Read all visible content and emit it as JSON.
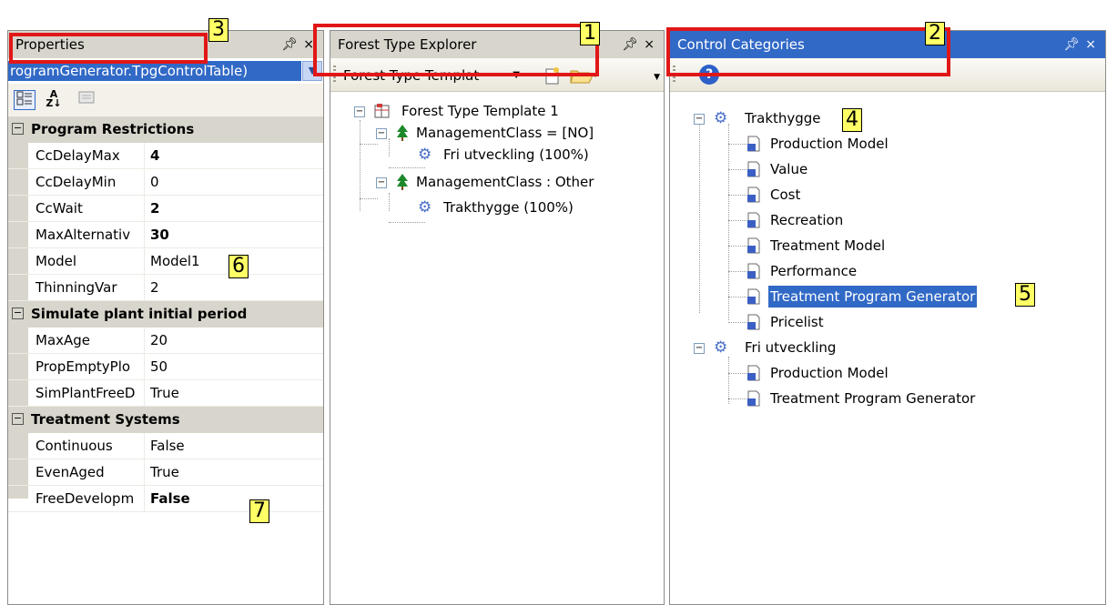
{
  "properties": {
    "title": "Properties",
    "selector": "rogramGenerator.TpgControlTable)",
    "categories": [
      {
        "name": "Program Restrictions",
        "rows": [
          {
            "key": "CcDelayMax",
            "value": "4",
            "bold": true
          },
          {
            "key": "CcDelayMin",
            "value": "0",
            "bold": false
          },
          {
            "key": "CcWait",
            "value": "2",
            "bold": true
          },
          {
            "key": "MaxAlternativ",
            "value": "30",
            "bold": true
          },
          {
            "key": "Model",
            "value": "Model1",
            "bold": false
          },
          {
            "key": "ThinningVar",
            "value": "2",
            "bold": false
          }
        ]
      },
      {
        "name": "Simulate plant initial period",
        "rows": [
          {
            "key": "MaxAge",
            "value": "20",
            "bold": false
          },
          {
            "key": "PropEmptyPlo",
            "value": "50",
            "bold": false
          },
          {
            "key": "SimPlantFreeD",
            "value": "True",
            "bold": false
          }
        ]
      },
      {
        "name": "Treatment Systems",
        "rows": [
          {
            "key": "Continuous",
            "value": "False",
            "bold": false
          },
          {
            "key": "EvenAged",
            "value": "True",
            "bold": false
          },
          {
            "key": "FreeDevelopm",
            "value": "False",
            "bold": true
          }
        ]
      }
    ]
  },
  "explorer": {
    "title": "Forest Type Explorer",
    "dropdown": "Forest Type Templat",
    "root": "Forest Type Template 1",
    "class1": "ManagementClass = [NO]",
    "class1_child": "Fri utveckling (100%)",
    "class2": "ManagementClass : Other",
    "class2_child": "Trakthygge (100%)"
  },
  "categories": {
    "title": "Control Categories",
    "group1": "Trakthygge",
    "group1_items": [
      "Production Model",
      "Value",
      "Cost",
      "Recreation",
      "Treatment Model",
      "Performance",
      "Treatment Program Generator",
      "Pricelist"
    ],
    "group2": "Fri utveckling",
    "group2_items": [
      "Production Model",
      "Treatment Program Generator"
    ]
  },
  "annotations": [
    "1",
    "2",
    "3",
    "4",
    "5",
    "6",
    "7"
  ],
  "icons": {
    "pin": "pin-icon",
    "close": "close-icon",
    "gear": "gear-icon",
    "doc": "document-icon",
    "tree": "tree-icon",
    "help": "help-icon"
  }
}
